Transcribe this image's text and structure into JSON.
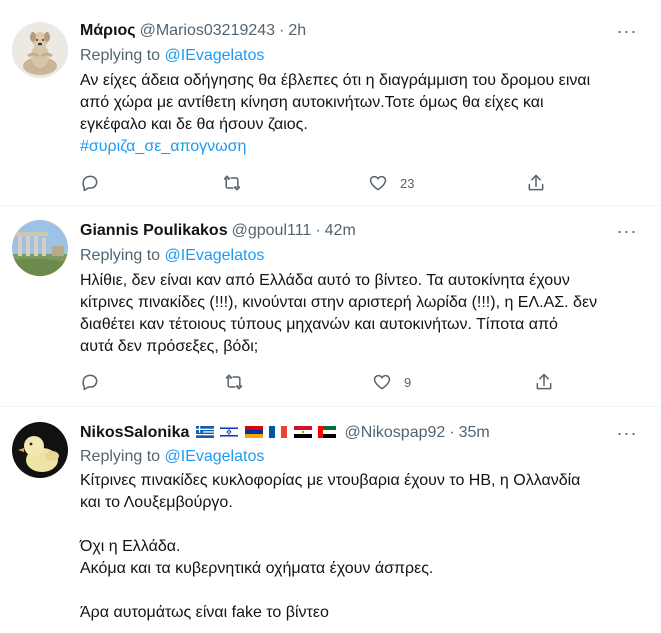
{
  "tweets": [
    {
      "name": "Μάριος",
      "handle": "@Marios03219243",
      "time": "2h",
      "replying_prefix": "Replying to",
      "replying_to": "@IEvagelatos",
      "text_lines": [
        "Αν είχες άδεια οδήγησης θα έβλεπες ότι η διαγράμμιση του δρομου ειναι",
        "από χώρα με αντίθετη κίνηση αυτοκινήτων.Τοτε όμως θα είχες και",
        "εγκέφαλο και δε θα ήσουν ζαιος."
      ],
      "hashtag": "#συριζα_σε_απογνωση",
      "likes": "23",
      "avatar_icon": "meditating-dog-avatar"
    },
    {
      "name": "Giannis Poulikakos",
      "handle": "@gpoul111",
      "time": "42m",
      "replying_prefix": "Replying to",
      "replying_to": "@IEvagelatos",
      "text_lines": [
        "Ηλίθιε, δεν είναι καν από Ελλάδα αυτό το βίντεο. Τα αυτοκίνητα έχουν",
        "κίτρινες πινακίδες (!!!), κινούνται στην αριστερή λωρίδα (!!!), η ΕΛ.ΑΣ. δεν",
        "διαθέτει καν τέτοιους τύπους μηχανών και αυτοκινήτων. Τίποτα από",
        "αυτά δεν πρόσεξες, βόδι;"
      ],
      "likes": "9",
      "avatar_icon": "ruins-landscape-avatar"
    },
    {
      "name": "NikosSalonika",
      "handle": "@Nikospap92",
      "time": "35m",
      "replying_prefix": "Replying to",
      "replying_to": "@IEvagelatos",
      "flags": [
        "greece-flag",
        "israel-flag",
        "armenia-flag",
        "france-flag",
        "egypt-flag",
        "uae-flag"
      ],
      "text_lines": [
        "Κίτρινες πινακίδες κυκλοφορίας με ντουβαρια έχουν το ΗΒ, η Ολλανδία",
        "και το Λουξεμβούργο.",
        "",
        "Όχι η Ελλάδα.",
        "Ακόμα και τα κυβερνητικά οχήματα έχουν άσπρες.",
        "",
        "Άρα αυτομάτως είναι fake το βίντεο"
      ],
      "avatar_icon": "duckling-avatar"
    }
  ],
  "colors": {
    "accent": "#1d9bf0",
    "secondary_text": "#536471",
    "primary_text": "#0f1419",
    "divider": "#eff3f4"
  },
  "more_label": "···",
  "date_separator": "·"
}
